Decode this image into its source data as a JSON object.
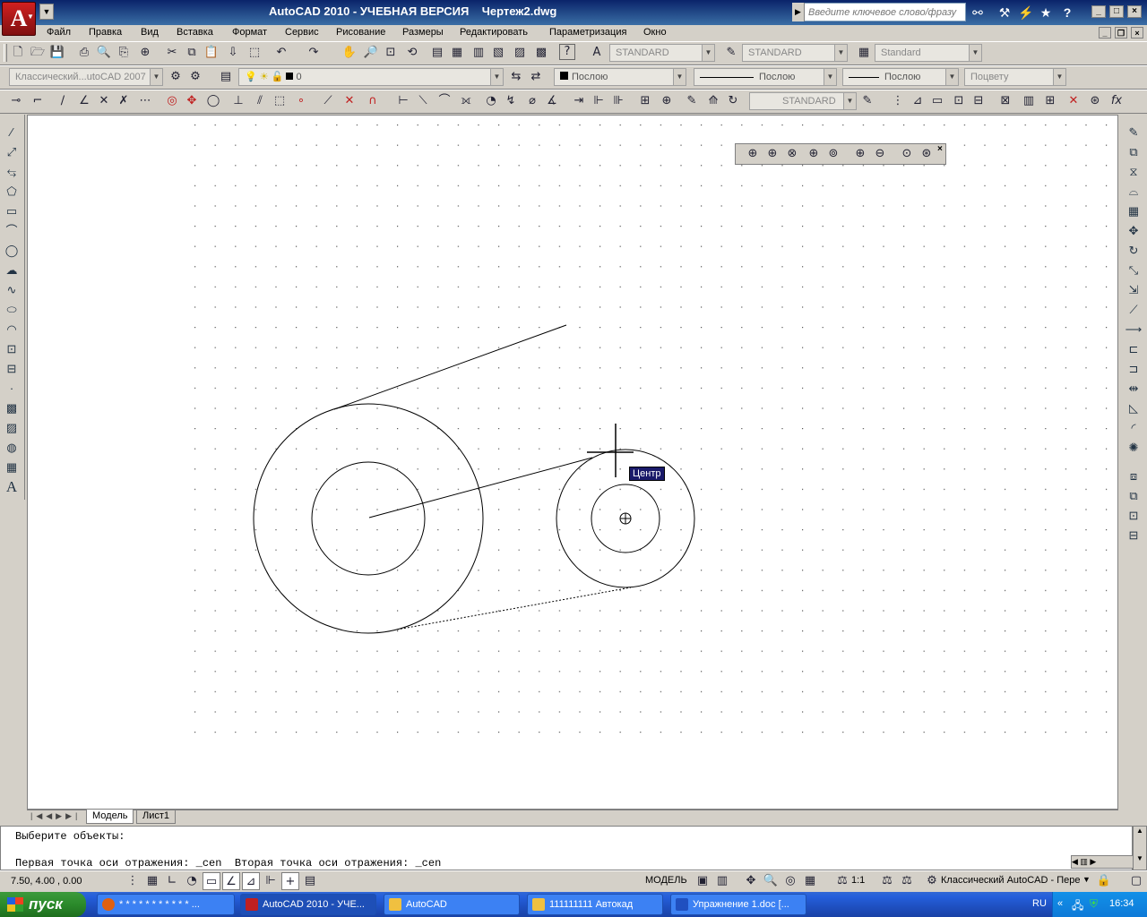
{
  "title": {
    "app": "AutoCAD 2010 - УЧЕБНАЯ ВЕРСИЯ    Чертеж2.dwg",
    "logo_letter": "A",
    "search_placeholder": "Введите ключевое слово/фразу"
  },
  "menu": [
    "Файл",
    "Правка",
    "Вид",
    "Вставка",
    "Формат",
    "Сервис",
    "Рисование",
    "Размеры",
    "Редактировать",
    "Параметризация",
    "Окно"
  ],
  "toolbar1": {
    "text_style": "STANDARD",
    "dim_style": "STANDARD",
    "table_style": "Standard"
  },
  "toolbar2": {
    "workspace": "Классический...utoCAD 2007",
    "layer": "0",
    "color": "Послою",
    "linetype": "Послою",
    "lineweight": "Послою",
    "plotstyle": "Поцвету"
  },
  "toolbar3": {
    "dim_style": "STANDARD"
  },
  "canvas": {
    "tooltip": "Центр"
  },
  "tabs": {
    "model": "Модель",
    "layout1": "Лист1"
  },
  "command": {
    "line1": "Выберите объекты:",
    "line2": "Первая точка оси отражения: _cen  Вторая точка оси отражения: _cen"
  },
  "status": {
    "coords": "7.50, 4.00 , 0.00",
    "model": "МОДЕЛЬ",
    "scale": "1:1",
    "workspace": "Классический AutoCAD - Пере"
  },
  "taskbar": {
    "start": "пуск",
    "items": [
      "* * * * * * * * * * * ...",
      "AutoCAD 2010 - УЧЕ...",
      "AutoCAD",
      "111111111 Автокад",
      "Упражнение 1.doc [..."
    ],
    "lang": "RU",
    "time": "16:34"
  }
}
